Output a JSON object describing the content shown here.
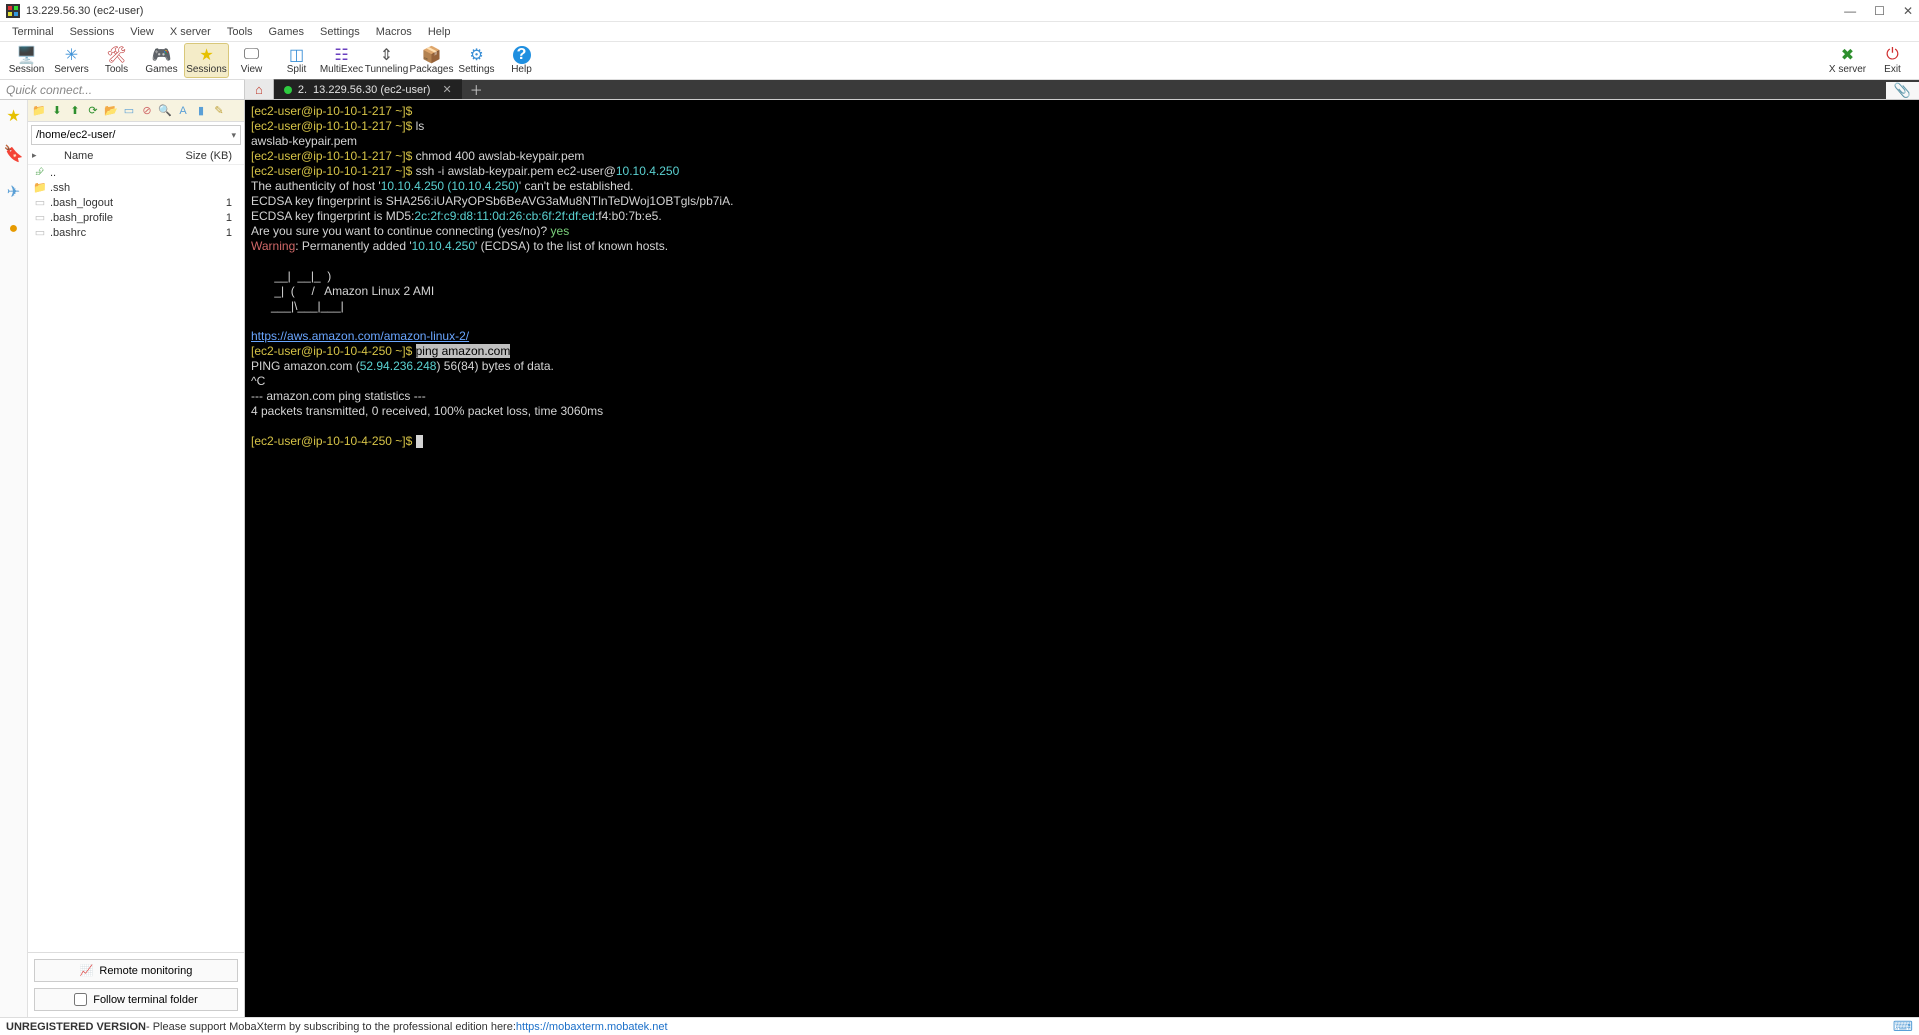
{
  "window": {
    "title": "13.229.56.30 (ec2-user)"
  },
  "menu": {
    "items": [
      "Terminal",
      "Sessions",
      "View",
      "X server",
      "Tools",
      "Games",
      "Settings",
      "Macros",
      "Help"
    ]
  },
  "toolbar": {
    "buttons": [
      {
        "id": "session",
        "label": "Session",
        "icon": "🖥️",
        "color": "#3a8fd6"
      },
      {
        "id": "servers",
        "label": "Servers",
        "icon": "✳",
        "color": "#3a8fd6"
      },
      {
        "id": "tools",
        "label": "Tools",
        "icon": "🛠",
        "color": "#c04040"
      },
      {
        "id": "games",
        "label": "Games",
        "icon": "🎮",
        "color": "#888"
      },
      {
        "id": "sessions",
        "label": "Sessions",
        "icon": "★",
        "color": "#e6c100",
        "active": true
      },
      {
        "id": "view",
        "label": "View",
        "icon": "🖵",
        "color": "#555"
      },
      {
        "id": "split",
        "label": "Split",
        "icon": "◫",
        "color": "#3a8fd6"
      },
      {
        "id": "multiexec",
        "label": "MultiExec",
        "icon": "☷",
        "color": "#6a3fbf"
      },
      {
        "id": "tunneling",
        "label": "Tunneling",
        "icon": "⇕",
        "color": "#555"
      },
      {
        "id": "packages",
        "label": "Packages",
        "icon": "📦",
        "color": "#7a6f5a"
      },
      {
        "id": "settings",
        "label": "Settings",
        "icon": "⚙",
        "color": "#3a8fd6"
      },
      {
        "id": "helpbtn",
        "label": "Help",
        "icon": "?",
        "color": "#fff",
        "bg": "#1f8fe0"
      }
    ],
    "right": [
      {
        "id": "xserver",
        "label": "X server",
        "icon": "✖",
        "color": "#2e8f2e"
      },
      {
        "id": "exit",
        "label": "Exit",
        "icon": "⏻",
        "color": "#d03030"
      }
    ]
  },
  "quick_connect": {
    "placeholder": "Quick connect..."
  },
  "tabs": {
    "home_icon": "⌂",
    "active": {
      "index": "2.",
      "label": "13.229.56.30 (ec2-user)"
    }
  },
  "sidebar_icons": [
    "★",
    "🔖",
    "✈",
    "●"
  ],
  "filepanel": {
    "path": "/home/ec2-user/",
    "columns": {
      "name": "Name",
      "size": "Size (KB)"
    },
    "rows": [
      {
        "icon": "up",
        "name": "..",
        "size": ""
      },
      {
        "icon": "folder",
        "name": ".ssh",
        "size": ""
      },
      {
        "icon": "file",
        "name": ".bash_logout",
        "size": "1"
      },
      {
        "icon": "file",
        "name": ".bash_profile",
        "size": "1"
      },
      {
        "icon": "file",
        "name": ".bashrc",
        "size": "1"
      }
    ],
    "remote_btn": "Remote monitoring",
    "follow_chk": "Follow terminal folder"
  },
  "terminal": {
    "lines": [
      [
        {
          "t": "[ec2-user@ip-10-10-1-217 ~]$",
          "c": "yl"
        }
      ],
      [
        {
          "t": "[ec2-user@ip-10-10-1-217 ~]$ ",
          "c": "yl"
        },
        {
          "t": "ls",
          "c": "pr"
        }
      ],
      [
        {
          "t": "awslab-keypair.pem",
          "c": "pr"
        }
      ],
      [
        {
          "t": "[ec2-user@ip-10-10-1-217 ~]$ ",
          "c": "yl"
        },
        {
          "t": "chmod 400 awslab-keypair.pem",
          "c": "pr"
        }
      ],
      [
        {
          "t": "[ec2-user@ip-10-10-1-217 ~]$ ",
          "c": "yl"
        },
        {
          "t": "ssh -i awslab-keypair.pem ec2-user@",
          "c": "pr"
        },
        {
          "t": "10.10.4.250",
          "c": "cy"
        }
      ],
      [
        {
          "t": "The authenticity of host '",
          "c": "pr"
        },
        {
          "t": "10.10.4.250 (10.10.4.250)",
          "c": "cy"
        },
        {
          "t": "' can't be established.",
          "c": "pr"
        }
      ],
      [
        {
          "t": "ECDSA key fingerprint is SHA256:iUARyOPSb6BeAVG3aMu8NTlnTeDWoj1OBTgls/pb7iA.",
          "c": "pr"
        }
      ],
      [
        {
          "t": "ECDSA key fingerprint is MD5:",
          "c": "pr"
        },
        {
          "t": "2c:2f:c9:d8:11:0d:26:cb:6f:2f:df:ed",
          "c": "cy"
        },
        {
          "t": ":f4:b0:7b:e5.",
          "c": "pr"
        }
      ],
      [
        {
          "t": "Are you sure you want to continue connecting (yes/no)? ",
          "c": "pr"
        },
        {
          "t": "yes",
          "c": "gr"
        }
      ],
      [
        {
          "t": "Warning",
          "c": "rd"
        },
        {
          "t": ": Permanently added '",
          "c": "pr"
        },
        {
          "t": "10.10.4.250",
          "c": "cy"
        },
        {
          "t": "' (ECDSA) to the list of known hosts.",
          "c": "pr"
        }
      ],
      [
        {
          "t": "",
          "c": "pr"
        }
      ],
      [
        {
          "t": "       __|  __|_  )",
          "c": "pr"
        }
      ],
      [
        {
          "t": "       _|  (     /   Amazon Linux 2 AMI",
          "c": "pr"
        }
      ],
      [
        {
          "t": "      ___|\\___|___|",
          "c": "pr"
        }
      ],
      [
        {
          "t": "",
          "c": "pr"
        }
      ],
      [
        {
          "t": "https://aws.amazon.com/amazon-linux-2/",
          "c": "bl"
        }
      ],
      [
        {
          "t": "[ec2-user@ip-10-10-4-250 ~]$ ",
          "c": "yl"
        },
        {
          "t": "ping amazon.com",
          "c": "sel"
        }
      ],
      [
        {
          "t": "PING amazon.com (",
          "c": "pr"
        },
        {
          "t": "52.94.236.248",
          "c": "cy"
        },
        {
          "t": ") 56(84) bytes of data.",
          "c": "pr"
        }
      ],
      [
        {
          "t": "^C",
          "c": "pr"
        }
      ],
      [
        {
          "t": "--- amazon.com ping statistics ---",
          "c": "pr"
        }
      ],
      [
        {
          "t": "4 packets transmitted, 0 received, 100% packet loss, time 3060ms",
          "c": "pr"
        }
      ],
      [
        {
          "t": "",
          "c": "pr"
        }
      ],
      [
        {
          "t": "[ec2-user@ip-10-10-4-250 ~]$ ",
          "c": "yl"
        },
        {
          "t": "",
          "c": "cursor"
        }
      ]
    ]
  },
  "status": {
    "prefix": "UNREGISTERED VERSION",
    "text": " - Please support MobaXterm by subscribing to the professional edition here: ",
    "link": "https://mobaxterm.mobatek.net"
  }
}
